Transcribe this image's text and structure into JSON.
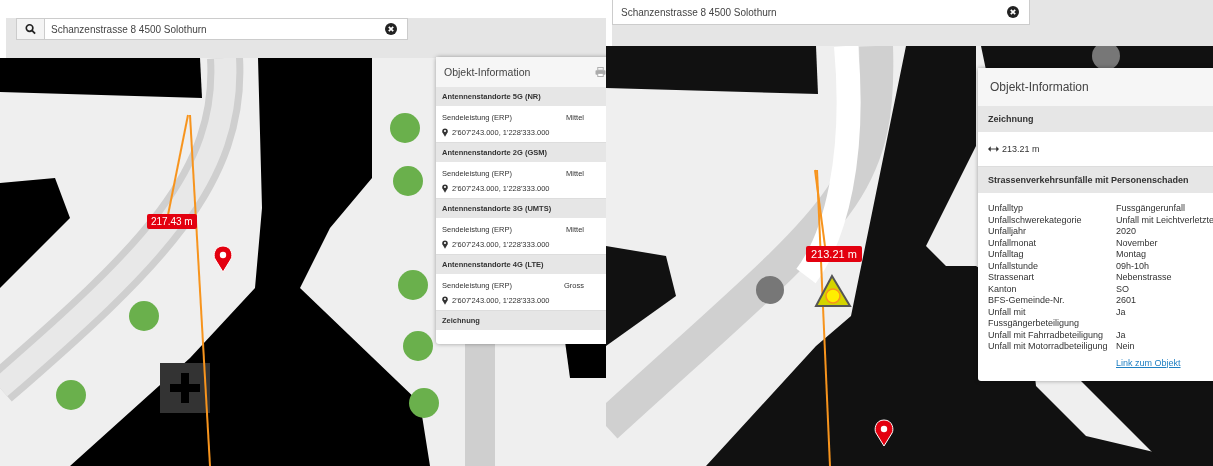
{
  "panes": [
    {
      "kind": "antenna",
      "search": {
        "value": "Schanzenstrasse 8 4500 Solothurn"
      },
      "measure_label": "217.43 m",
      "info_panel": {
        "title": "Objekt-Information",
        "sections": [
          {
            "kind": "antenna",
            "heading": "Antennenstandorte 5G (NR)",
            "label": "Sendeleistung (ERP)",
            "value": "Mittel",
            "coordinates": "2'607'243.000, 1'228'333.000"
          },
          {
            "kind": "antenna",
            "heading": "Antennenstandorte 2G (GSM)",
            "label": "Sendeleistung (ERP)",
            "value": "Mittel",
            "coordinates": "2'607'243.000, 1'228'333.000"
          },
          {
            "kind": "antenna",
            "heading": "Antennenstandorte 3G (UMTS)",
            "label": "Sendeleistung (ERP)",
            "value": "Mittel",
            "coordinates": "2'607'243.000, 1'228'333.000"
          },
          {
            "kind": "antenna",
            "heading": "Antennenstandorte 4G (LTE)",
            "label": "Sendeleistung (ERP)",
            "value": "Gross",
            "coordinates": "2'607'243.000, 1'228'333.000"
          },
          {
            "kind": "heading",
            "heading": "Zeichnung"
          }
        ]
      }
    },
    {
      "kind": "accident",
      "search": {
        "value": "Schanzenstrasse 8 4500 Solothurn"
      },
      "measure_label": "213.21 m",
      "info_panel": {
        "title": "Objekt-Information",
        "sections": [
          {
            "kind": "measurement",
            "heading": "Zeichnung",
            "distance": "213.21 m"
          },
          {
            "kind": "attributes",
            "heading": "Strassenverkehrsunfälle mit Personenschaden",
            "rows": [
              {
                "label": "Unfalltyp",
                "value": "Fussgängerunfall"
              },
              {
                "label": "Unfallschwerekategorie",
                "value": "Unfall mit Leichtverletzte"
              },
              {
                "label": "Unfalljahr",
                "value": "2020"
              },
              {
                "label": "Unfallmonat",
                "value": "November"
              },
              {
                "label": "Unfalltag",
                "value": "Montag"
              },
              {
                "label": "Unfallstunde",
                "value": "09h-10h"
              },
              {
                "label": "Strassenart",
                "value": "Nebenstrasse"
              },
              {
                "label": "Kanton",
                "value": "SO"
              },
              {
                "label": "BFS-Gemeinde-Nr.",
                "value": "2601"
              },
              {
                "label": "Unfall mit Fussgängerbeteiligung",
                "value": "Ja"
              },
              {
                "label": "Unfall mit Fahrradbeteiligung",
                "value": "Ja"
              },
              {
                "label": "Unfall mit Motorradbeteiligung",
                "value": "Nein"
              }
            ],
            "link": "Link zum Objekt"
          }
        ]
      }
    }
  ]
}
